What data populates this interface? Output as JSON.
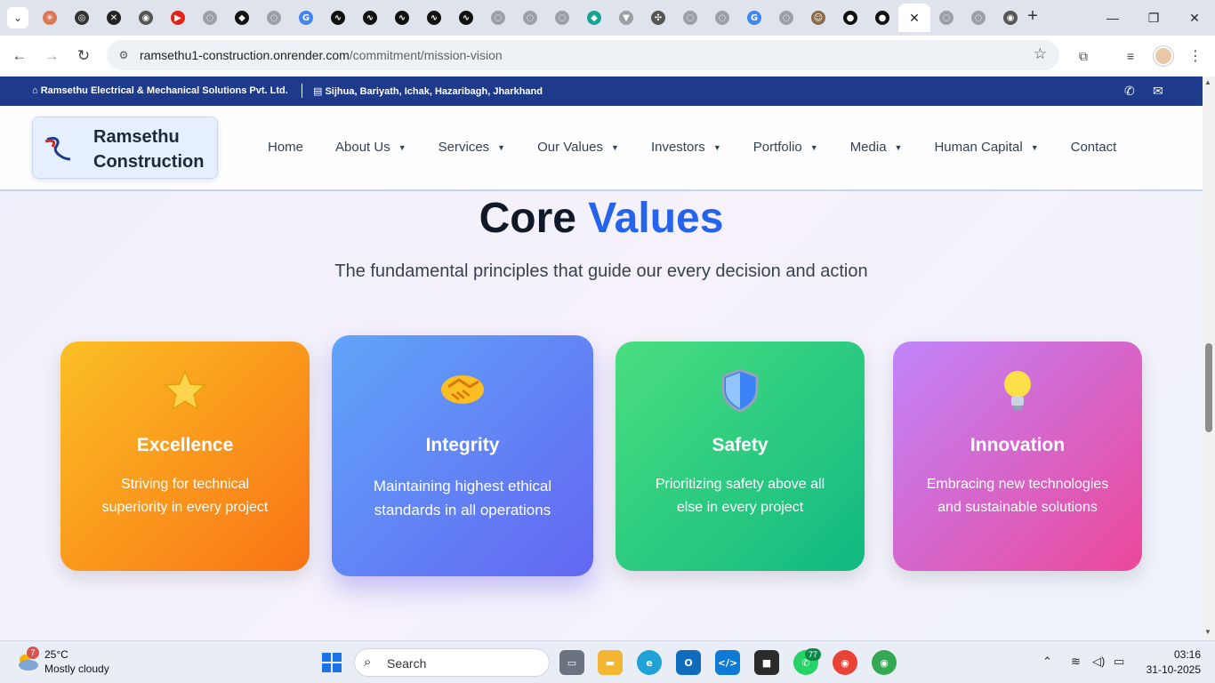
{
  "browser": {
    "tabs": [
      {
        "icon": "chevron-down-icon"
      },
      {
        "icon": "claude-icon",
        "color": "#d97757",
        "glyph": "✳"
      },
      {
        "icon": "openai-icon",
        "color": "#333333",
        "glyph": "◎"
      },
      {
        "icon": "x-icon",
        "color": "#222222",
        "glyph": "✕"
      },
      {
        "icon": "chrome-icon",
        "color": "#555555",
        "glyph": "◉"
      },
      {
        "icon": "youtube-icon",
        "color": "#e62117",
        "glyph": "▶"
      },
      {
        "icon": "globe-icon",
        "color": "#9aa0a6",
        "glyph": "◌"
      },
      {
        "icon": "leaf-icon",
        "color": "#111111",
        "glyph": "◆"
      },
      {
        "icon": "globe-icon",
        "color": "#9aa0a6",
        "glyph": "◌"
      },
      {
        "icon": "google-icon",
        "color": "#4285f4",
        "glyph": "G"
      },
      {
        "icon": "wave-icon",
        "color": "#111111",
        "glyph": "∿"
      },
      {
        "icon": "wave-icon",
        "color": "#111111",
        "glyph": "∿"
      },
      {
        "icon": "wave-icon",
        "color": "#111111",
        "glyph": "∿"
      },
      {
        "icon": "wave-icon",
        "color": "#111111",
        "glyph": "∿"
      },
      {
        "icon": "wave-icon",
        "color": "#111111",
        "glyph": "∿"
      },
      {
        "icon": "globe-icon",
        "color": "#9aa0a6",
        "glyph": "◌"
      },
      {
        "icon": "globe-icon",
        "color": "#9aa0a6",
        "glyph": "◌"
      },
      {
        "icon": "globe-icon",
        "color": "#9aa0a6",
        "glyph": "◌"
      },
      {
        "icon": "diamond-icon",
        "color": "#16a394",
        "glyph": "◆"
      },
      {
        "icon": "shield-tab-icon",
        "color": "#9aa0a6",
        "glyph": "▼"
      },
      {
        "icon": "sparkle-icon",
        "color": "#555555",
        "glyph": "✣"
      },
      {
        "icon": "globe-icon",
        "color": "#9aa0a6",
        "glyph": "◌"
      },
      {
        "icon": "globe-icon",
        "color": "#9aa0a6",
        "glyph": "◌"
      },
      {
        "icon": "google-icon",
        "color": "#4285f4",
        "glyph": "G"
      },
      {
        "icon": "globe-icon",
        "color": "#9aa0a6",
        "glyph": "◌"
      },
      {
        "icon": "person-tab-icon",
        "color": "#8a6a4a",
        "glyph": "☺"
      },
      {
        "icon": "github-icon",
        "color": "#111111",
        "glyph": "●"
      },
      {
        "icon": "github-icon",
        "color": "#111111",
        "glyph": "●"
      },
      {
        "icon": "close-tab-icon",
        "active": true,
        "glyph": "✕"
      },
      {
        "icon": "globe-icon",
        "color": "#9aa0a6",
        "glyph": "◌"
      },
      {
        "icon": "globe-icon",
        "color": "#9aa0a6",
        "glyph": "◌"
      },
      {
        "icon": "chrome-icon",
        "color": "#555555",
        "glyph": "◉"
      }
    ],
    "url_host": "ramsethu1-construction.onrender.com",
    "url_path": "/commitment/mission-vision"
  },
  "topbar": {
    "company": "Ramsethu Electrical & Mechanical Solutions Pvt. Ltd.",
    "location": "Sijhua, Bariyath, Ichak, Hazaribagh, Jharkhand"
  },
  "header": {
    "logo_line1": "Ramsethu",
    "logo_line2": "Construction",
    "nav": [
      {
        "label": "Home",
        "dropdown": false
      },
      {
        "label": "About Us",
        "dropdown": true
      },
      {
        "label": "Services",
        "dropdown": true
      },
      {
        "label": "Our Values",
        "dropdown": true
      },
      {
        "label": "Investors",
        "dropdown": true
      },
      {
        "label": "Portfolio",
        "dropdown": true
      },
      {
        "label": "Media",
        "dropdown": true
      },
      {
        "label": "Human Capital",
        "dropdown": true
      },
      {
        "label": "Contact",
        "dropdown": false
      }
    ]
  },
  "section": {
    "heading_part1": "Core",
    "heading_part2": "Values",
    "subheading": "The fundamental principles that guide our every decision and action"
  },
  "cards": [
    {
      "title": "Excellence",
      "desc": "Striving for technical superiority in every project",
      "icon": "star-icon",
      "gradient": [
        "#fbbf24",
        "#f97316"
      ]
    },
    {
      "title": "Integrity",
      "desc": "Maintaining highest ethical standards in all operations",
      "icon": "handshake-icon",
      "gradient": [
        "#60a5fa",
        "#6366f1"
      ]
    },
    {
      "title": "Safety",
      "desc": "Prioritizing safety above all else in every project",
      "icon": "shield-icon",
      "gradient": [
        "#4ade80",
        "#10b981"
      ]
    },
    {
      "title": "Innovation",
      "desc": "Embracing new technologies and sustainable solutions",
      "icon": "lightbulb-icon",
      "gradient": [
        "#c084fc",
        "#ec4899"
      ]
    }
  ],
  "taskbar": {
    "weather_badge": "7",
    "temperature": "25°C",
    "condition": "Mostly cloudy",
    "search_label": "Search",
    "whatsapp_badge": "77",
    "time": "03:16",
    "date": "31-10-2025"
  }
}
